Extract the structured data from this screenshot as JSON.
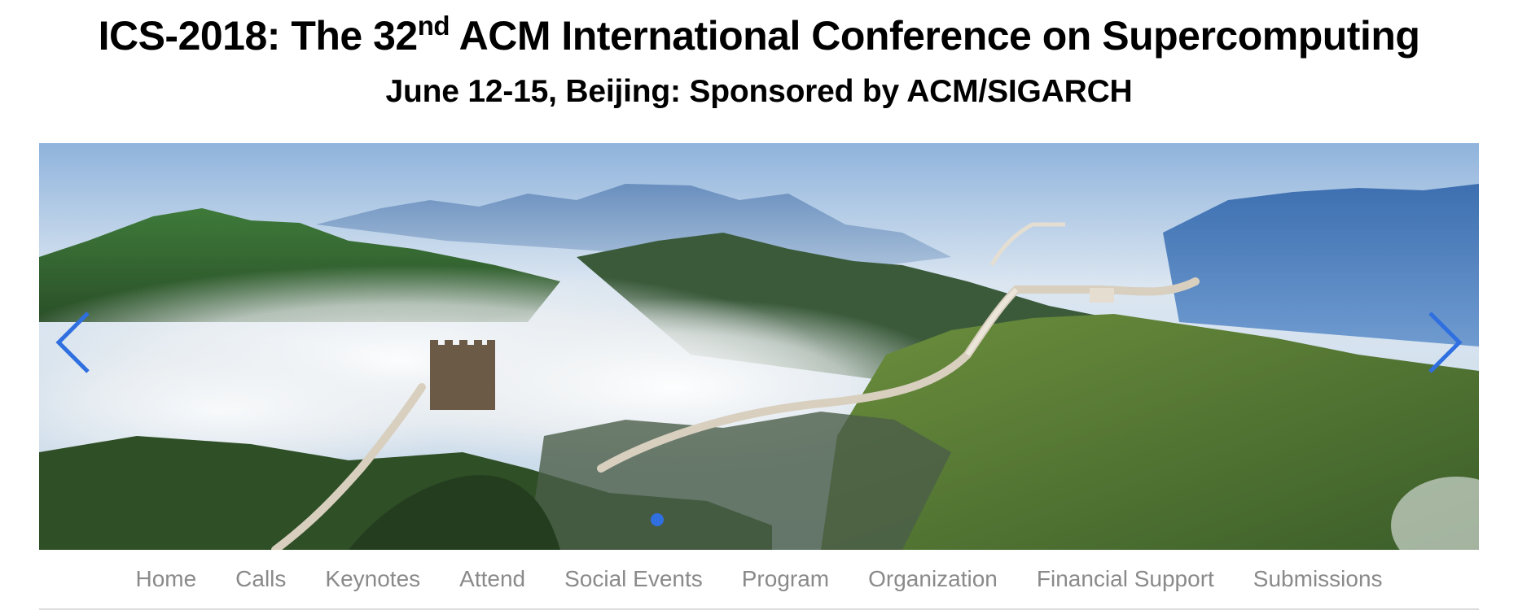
{
  "header": {
    "title_prefix": "ICS-2018: The 32",
    "title_sup": "nd",
    "title_suffix": " ACM International Conference on Supercomputing",
    "subtitle": "June 12-15, Beijing: Sponsored by ACM/SIGARCH"
  },
  "carousel": {
    "image": "great-wall-mountains-photo",
    "prev_icon": "chevron-left-icon",
    "next_icon": "chevron-right-icon",
    "indicator_count": 1,
    "active_indicator": 1,
    "accent_color": "#2f6fe0"
  },
  "nav": {
    "items": [
      {
        "label": "Home"
      },
      {
        "label": "Calls"
      },
      {
        "label": "Keynotes"
      },
      {
        "label": "Attend"
      },
      {
        "label": "Social Events"
      },
      {
        "label": "Program"
      },
      {
        "label": "Organization"
      },
      {
        "label": "Financial Support"
      },
      {
        "label": "Submissions"
      }
    ]
  }
}
